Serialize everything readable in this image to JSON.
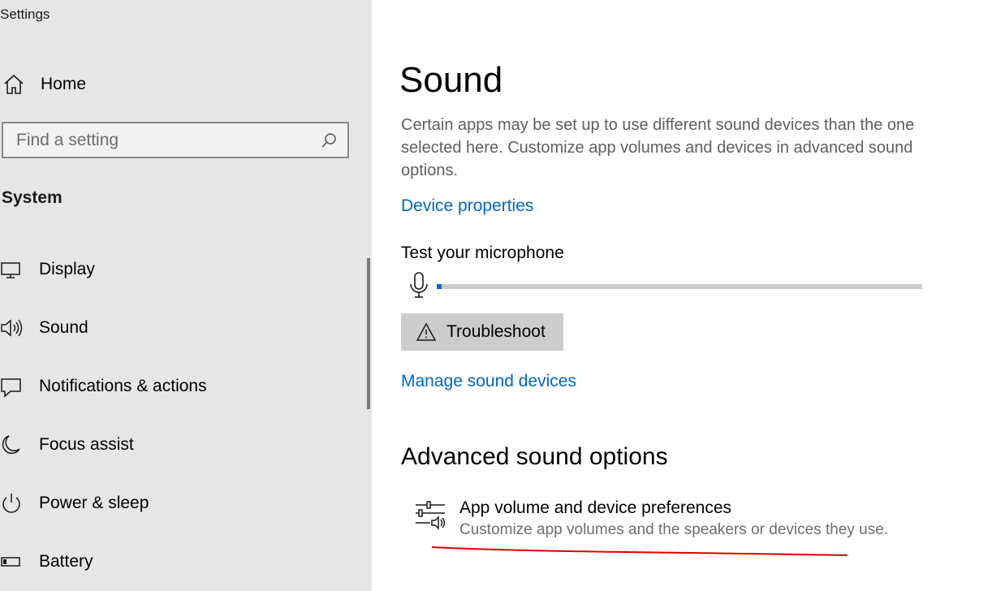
{
  "window": {
    "title": "Settings"
  },
  "sidebar": {
    "home_label": "Home",
    "search": {
      "placeholder": "Find a setting"
    },
    "section_title": "System",
    "items": [
      {
        "label": "Display",
        "icon": "monitor-icon"
      },
      {
        "label": "Sound",
        "icon": "speaker-icon"
      },
      {
        "label": "Notifications & actions",
        "icon": "notification-icon"
      },
      {
        "label": "Focus assist",
        "icon": "moon-icon"
      },
      {
        "label": "Power & sleep",
        "icon": "power-icon"
      },
      {
        "label": "Battery",
        "icon": "battery-icon"
      }
    ]
  },
  "main": {
    "title": "Sound",
    "description": "Certain apps may be set up to use different sound devices than the one selected here. Customize app volumes and devices in advanced sound options.",
    "device_properties_link": "Device properties",
    "mic_test": {
      "label": "Test your microphone",
      "level": 0.01
    },
    "troubleshoot_label": "Troubleshoot",
    "manage_devices_link": "Manage sound devices",
    "advanced": {
      "title": "Advanced sound options",
      "pref_title": "App volume and device preferences",
      "pref_subtitle": "Customize app volumes and the speakers or devices they use."
    }
  },
  "colors": {
    "accent": "#0067c0",
    "sidebar_bg": "#e6e6e6",
    "annotation": "#e00000"
  }
}
